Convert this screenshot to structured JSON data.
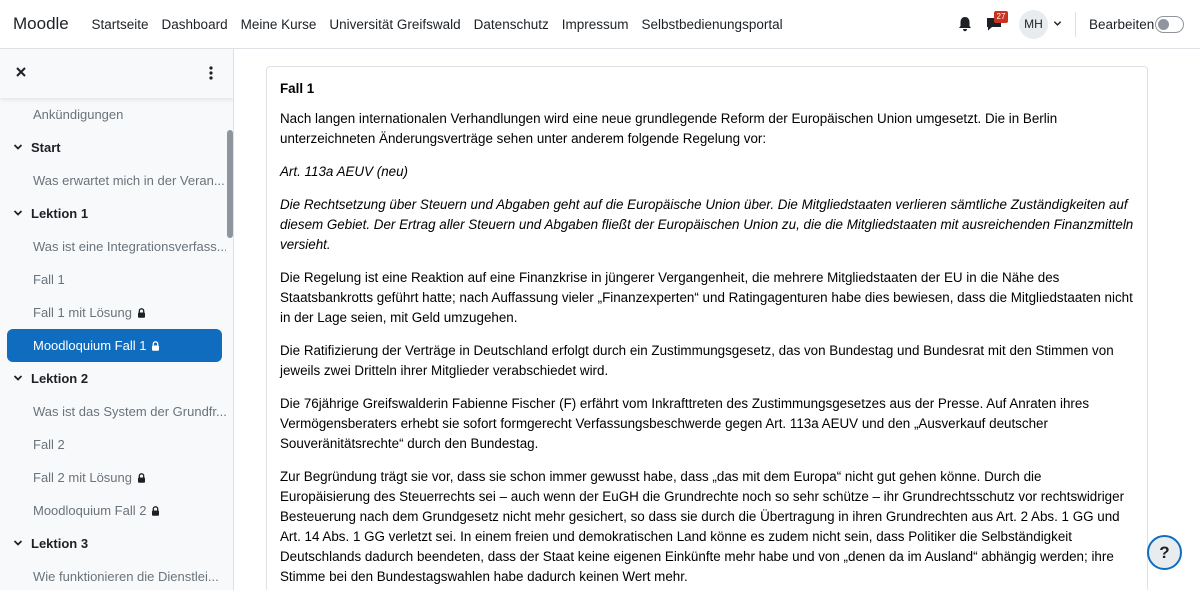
{
  "navbar": {
    "brand": "Moodle",
    "links": [
      "Startseite",
      "Dashboard",
      "Meine Kurse",
      "Universität Greifswald",
      "Datenschutz",
      "Impressum",
      "Selbstbedienungsportal"
    ],
    "message_count": "27",
    "avatar_initials": "MH",
    "edit_mode_label": "Bearbeiten"
  },
  "drawer": {
    "items": [
      {
        "type": "item",
        "label": "Ankündigungen"
      },
      {
        "type": "section",
        "label": "Start"
      },
      {
        "type": "item",
        "label": "Was erwartet mich in der Veran..."
      },
      {
        "type": "section",
        "label": "Lektion 1"
      },
      {
        "type": "item",
        "label": "Was ist eine Integrationsverfass..."
      },
      {
        "type": "item",
        "label": "Fall 1"
      },
      {
        "type": "item",
        "label": "Fall 1 mit Lösung",
        "locked": true
      },
      {
        "type": "item",
        "label": "Moodloquium Fall 1",
        "locked": true,
        "active": true
      },
      {
        "type": "section",
        "label": "Lektion 2"
      },
      {
        "type": "item",
        "label": "Was ist das System der Grundfr..."
      },
      {
        "type": "item",
        "label": "Fall 2"
      },
      {
        "type": "item",
        "label": "Fall 2 mit Lösung",
        "locked": true
      },
      {
        "type": "item",
        "label": "Moodloquium Fall 2",
        "locked": true
      },
      {
        "type": "section",
        "label": "Lektion 3"
      },
      {
        "type": "item",
        "label": "Wie funktionieren die Dienstlei..."
      }
    ]
  },
  "content": {
    "title": "Fall 1",
    "paragraphs": [
      {
        "text": "Nach langen internationalen Verhandlungen wird eine neue grundlegende Reform der Europäischen Union umgesetzt. Die in Berlin unterzeichneten Änderungsverträge sehen unter anderem folgende Regelung vor:",
        "italic": false
      },
      {
        "text": "Art. 113a AEUV (neu)",
        "italic": true
      },
      {
        "text": "Die Rechtsetzung über Steuern und Abgaben geht auf die Europäische Union über. Die Mitgliedstaaten verlieren sämtliche Zuständigkeiten auf diesem Gebiet. Der Ertrag aller Steuern und Abgaben fließt der Europäischen Union zu, die die Mitgliedstaaten mit ausreichenden Finanzmitteln versieht.",
        "italic": true
      },
      {
        "text": "Die Regelung ist eine Reaktion auf eine Finanzkrise in jüngerer Vergangenheit, die mehrere Mitgliedstaaten der EU in die Nähe des Staatsbankrotts geführt hatte; nach Auffassung vieler „Finanzexperten“ und Ratingagenturen habe dies bewiesen, dass die Mitgliedstaaten nicht in der Lage seien, mit Geld umzugehen.",
        "italic": false
      },
      {
        "text": "Die Ratifizierung der Verträge in Deutschland erfolgt durch ein Zustimmungsgesetz, das von Bundestag und Bundesrat mit den Stimmen von jeweils zwei Dritteln ihrer Mitglieder verabschiedet wird.",
        "italic": false
      },
      {
        "text": "Die 76jährige Greifswalderin Fabienne Fischer (F) erfährt vom Inkrafttreten des Zustimmungsgesetzes aus der Presse. Auf Anraten ihres Vermögensberaters erhebt sie sofort formgerecht Verfassungsbeschwerde gegen Art. 113a AEUV und den „Ausverkauf deutscher Souveränitätsrechte“ durch den Bundestag.",
        "italic": false
      },
      {
        "text": "Zur Begründung trägt sie vor, dass sie schon immer gewusst habe, dass „das mit dem Europa“ nicht gut gehen könne. Durch die Europäisierung des Steuerrechts sei – auch wenn der EuGH die Grundrechte noch so sehr schütze – ihr Grundrechtsschutz vor rechtswidriger Besteuerung nach dem Grundgesetz nicht mehr gesichert, so dass sie durch die Übertragung in ihren Grundrechten aus Art. 2 Abs. 1 GG und Art. 14 Abs. 1 GG verletzt sei. In einem freien und demokratischen Land könne es zudem nicht sein, dass Politiker die Selbständigkeit Deutschlands dadurch beendeten, dass der Staat keine eigenen Einkünfte mehr habe und von „denen da im Ausland“ abhängig werden; ihre Stimme bei den Bundestagswahlen habe dadurch keinen Wert mehr.",
        "italic": false
      }
    ]
  },
  "help_label": "?",
  "icons": {
    "notifications": "bell-icon",
    "messages": "chat-icon",
    "avatar_menu": "chevron-down-icon",
    "close_drawer": "close-icon",
    "drawer_menu": "kebab-menu-icon",
    "section_toggle": "chevron-down-icon",
    "restricted": "lock-icon"
  },
  "colors": {
    "primary": "#0f6cbf",
    "badge": "#ca3120"
  }
}
